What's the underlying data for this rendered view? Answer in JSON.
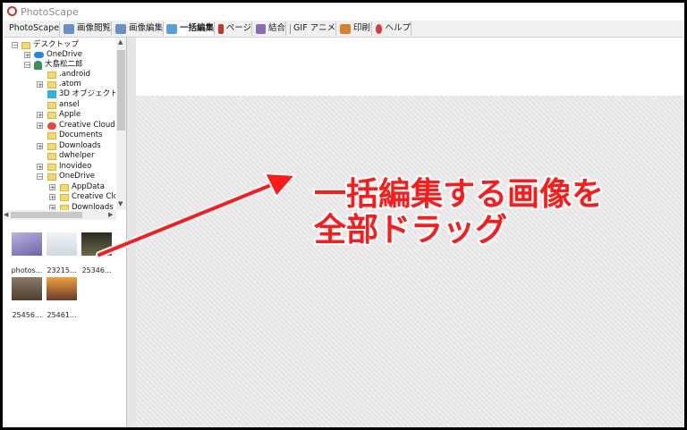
{
  "window": {
    "title": "PhotoScape"
  },
  "tabs": [
    {
      "label": "PhotoScape",
      "icon": "photoscape-icon",
      "color": "#d9a33a"
    },
    {
      "label": "画像閲覧",
      "icon": "viewer-icon",
      "color": "#6a8fc9"
    },
    {
      "label": "画像編集",
      "icon": "editor-icon",
      "color": "#6a8fc9"
    },
    {
      "label": "一括編集",
      "icon": "batch-icon",
      "color": "#5aa0d6"
    },
    {
      "label": "ページ",
      "icon": "page-icon",
      "color": "#c0392b"
    },
    {
      "label": "結合",
      "icon": "combine-icon",
      "color": "#8e6bb8"
    },
    {
      "label": "GIF アニメ",
      "icon": "gif-icon",
      "color": "#7a9cc2"
    },
    {
      "label": "印刷",
      "icon": "print-icon",
      "color": "#d9822b"
    },
    {
      "label": "ヘルプ",
      "icon": "help-icon",
      "color": "#d83a3a"
    }
  ],
  "tree": [
    {
      "label": "デスクトップ",
      "icon": "folder-icon"
    },
    {
      "label": "OneDrive",
      "icon": "cloud-icon"
    },
    {
      "label": "大島松二郎",
      "icon": "user-icon"
    },
    {
      "label": ".android",
      "icon": "folder-icon"
    },
    {
      "label": ".atom",
      "icon": "folder-icon"
    },
    {
      "label": "3D オブジェクト",
      "icon": "3d-objects-icon"
    },
    {
      "label": "ansel",
      "icon": "folder-icon"
    },
    {
      "label": "Apple",
      "icon": "folder-icon"
    },
    {
      "label": "Creative Cloud",
      "icon": "creative-cloud-icon"
    },
    {
      "label": "Documents",
      "icon": "folder-icon"
    },
    {
      "label": "Downloads",
      "icon": "folder-icon"
    },
    {
      "label": "dwhelper",
      "icon": "folder-icon"
    },
    {
      "label": "Inovideo",
      "icon": "folder-icon"
    },
    {
      "label": "OneDrive",
      "icon": "folder-icon"
    },
    {
      "label": "AppData",
      "icon": "folder-icon"
    },
    {
      "label": "Creative Clo",
      "icon": "folder-icon"
    },
    {
      "label": "Downloads",
      "icon": "folder-icon"
    }
  ],
  "thumbnails": [
    {
      "caption": "photos...",
      "color": "#8a7fb8"
    },
    {
      "caption": "23215...",
      "color": "#dfe6ea"
    },
    {
      "caption": "25346...",
      "color": "#3a3a2a"
    },
    {
      "caption": "25456...",
      "color": "#6b5a4a"
    },
    {
      "caption": "25461...",
      "color": "#d98a3a"
    }
  ],
  "annotation": {
    "line1": "一括編集する画像を",
    "line2": "全部ドラッグ",
    "color": "#ff1a1a"
  }
}
